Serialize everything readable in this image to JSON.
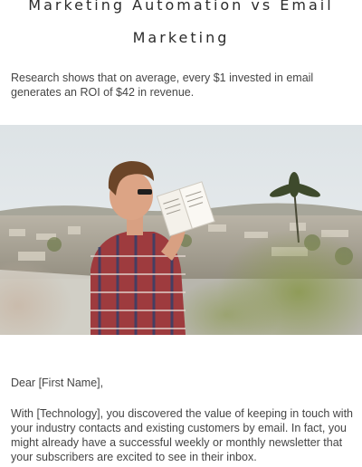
{
  "email": {
    "title_line1": "Marketing Automation vs Email",
    "title_line2": "Marketing",
    "intro": "Research shows that on average, every $1 invested in email generates an ROI of $42 in revenue.",
    "salutation": "Dear [First Name],",
    "body": "With [Technology], you discovered the value of keeping in touch with your industry contacts and existing customers by email. In fact, you might already have a successful weekly or monthly newsletter that your subscribers are excited to see in their inbox."
  }
}
